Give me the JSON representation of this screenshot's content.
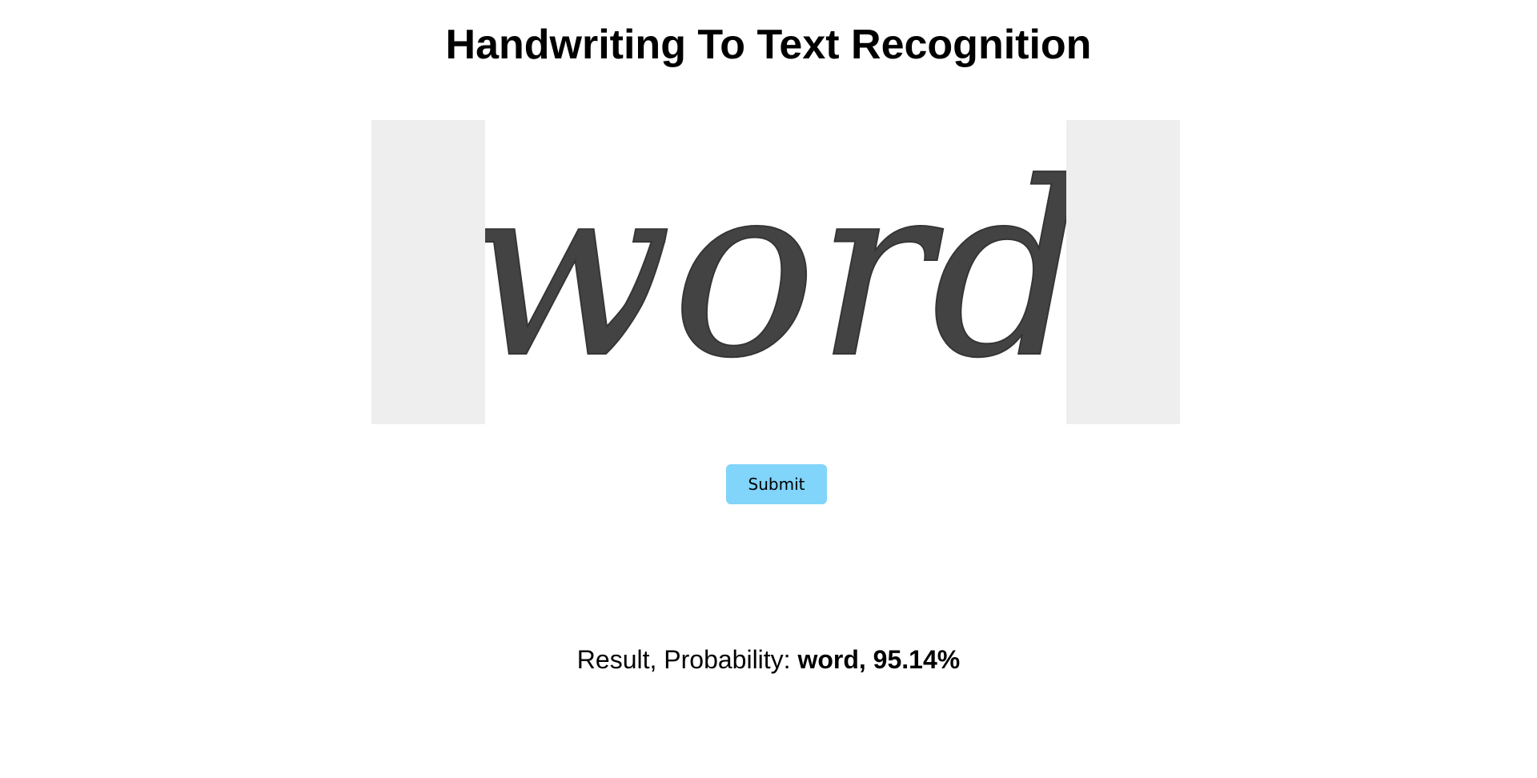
{
  "page": {
    "title": "Handwriting To Text Recognition"
  },
  "upload": {
    "handwritten_word": "word"
  },
  "actions": {
    "submit_label": "Submit"
  },
  "result": {
    "label": "Result, Probability: ",
    "value": "word, 95.14%"
  },
  "colors": {
    "submit_bg": "#81d4fa",
    "panel_bg": "#eeeeee"
  }
}
